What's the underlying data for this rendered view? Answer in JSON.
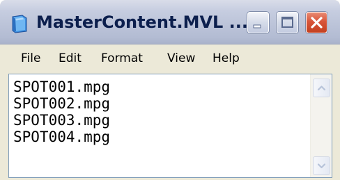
{
  "window": {
    "title": "MasterContent.MVL ...",
    "icon": "notepad-icon",
    "controls": {
      "minimize_icon": "minimize-icon",
      "maximize_icon": "maximize-icon",
      "close_icon": "close-icon"
    }
  },
  "menu": {
    "items": [
      {
        "label": "File"
      },
      {
        "label": "Edit"
      },
      {
        "label": "Format"
      },
      {
        "label": "View"
      },
      {
        "label": "Help"
      }
    ]
  },
  "editor": {
    "lines": [
      "SPOT001.mpg",
      "SPOT002.mpg",
      "SPOT003.mpg",
      "SPOT004.mpg"
    ],
    "scrollbar": {
      "up_icon": "arrow-up-icon",
      "down_icon": "arrow-down-icon"
    }
  },
  "colors": {
    "title_text": "#0c1f4d",
    "close_button": "#d8553a",
    "window_face": "#ece9d8",
    "editor_border": "#7f9db9"
  }
}
